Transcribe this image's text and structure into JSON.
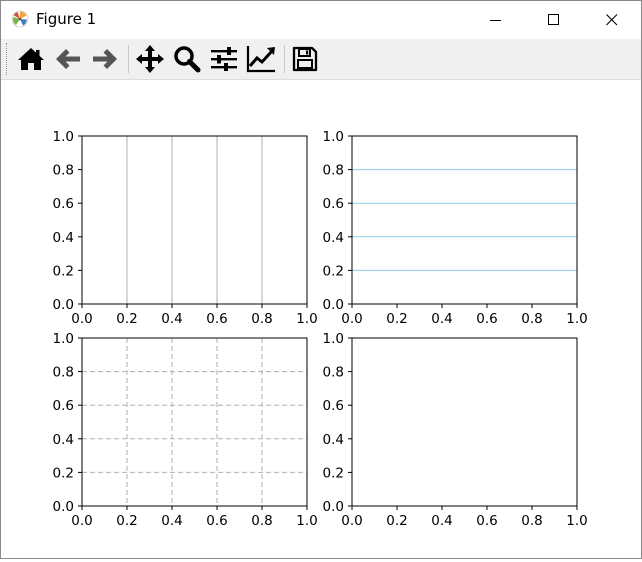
{
  "window": {
    "title": "Figure 1"
  },
  "toolbar": {
    "buttons": [
      {
        "name": "home",
        "icon": "home-icon"
      },
      {
        "name": "back",
        "icon": "arrow-left-icon"
      },
      {
        "name": "forward",
        "icon": "arrow-right-icon"
      },
      {
        "name": "pan",
        "icon": "move-arrows-icon"
      },
      {
        "name": "zoom",
        "icon": "magnifier-icon"
      },
      {
        "name": "subplots",
        "icon": "sliders-icon"
      },
      {
        "name": "edit-axes",
        "icon": "line-chart-icon"
      },
      {
        "name": "save",
        "icon": "floppy-disk-icon"
      }
    ]
  },
  "colors": {
    "grid_gray": "#b0b0b0",
    "grid_blue": "#87ceeb",
    "axis": "#000000",
    "toolbar_bg": "#f0f0f0"
  },
  "chart_data": [
    {
      "type": "line",
      "title": "",
      "xlabel": "",
      "ylabel": "",
      "xlim": [
        0,
        1
      ],
      "ylim": [
        0,
        1
      ],
      "x": [],
      "series": [],
      "xticks": [
        "0.0",
        "0.2",
        "0.4",
        "0.6",
        "0.8",
        "1.0"
      ],
      "yticks": [
        "0.0",
        "0.2",
        "0.4",
        "0.6",
        "0.8",
        "1.0"
      ],
      "grid": {
        "axis": "x",
        "style": "solid",
        "color": "gray"
      }
    },
    {
      "type": "line",
      "title": "",
      "xlabel": "",
      "ylabel": "",
      "xlim": [
        0,
        1
      ],
      "ylim": [
        0,
        1
      ],
      "x": [],
      "series": [],
      "xticks": [
        "0.0",
        "0.2",
        "0.4",
        "0.6",
        "0.8",
        "1.0"
      ],
      "yticks": [
        "0.0",
        "0.2",
        "0.4",
        "0.6",
        "0.8",
        "1.0"
      ],
      "grid": {
        "axis": "y",
        "style": "solid",
        "color": "skyblue"
      }
    },
    {
      "type": "line",
      "title": "",
      "xlabel": "",
      "ylabel": "",
      "xlim": [
        0,
        1
      ],
      "ylim": [
        0,
        1
      ],
      "x": [],
      "series": [],
      "xticks": [
        "0.0",
        "0.2",
        "0.4",
        "0.6",
        "0.8",
        "1.0"
      ],
      "yticks": [
        "0.0",
        "0.2",
        "0.4",
        "0.6",
        "0.8",
        "1.0"
      ],
      "grid": {
        "axis": "both",
        "style": "dashed",
        "color": "gray"
      }
    },
    {
      "type": "line",
      "title": "",
      "xlabel": "",
      "ylabel": "",
      "xlim": [
        0,
        1
      ],
      "ylim": [
        0,
        1
      ],
      "x": [],
      "series": [],
      "xticks": [
        "0.0",
        "0.2",
        "0.4",
        "0.6",
        "0.8",
        "1.0"
      ],
      "yticks": [
        "0.0",
        "0.2",
        "0.4",
        "0.6",
        "0.8",
        "1.0"
      ],
      "grid": {
        "axis": "none"
      }
    }
  ]
}
